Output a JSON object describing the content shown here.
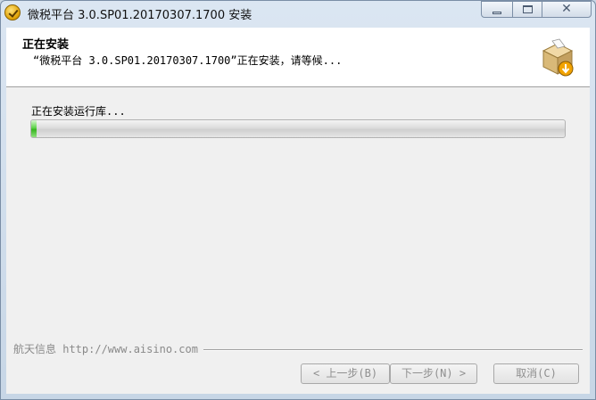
{
  "window": {
    "title": "微税平台 3.0.SP01.20170307.1700 安装",
    "close_glyph": "✕"
  },
  "header": {
    "title": "正在安装",
    "subtitle": "“微税平台 3.0.SP01.20170307.1700”正在安装，请等候..."
  },
  "body": {
    "status_text": "正在安装运行库...",
    "progress_fraction": 0.01
  },
  "footer": {
    "brand_text": "航天信息 http://www.aisino.com",
    "back_label": "< 上一步(B)",
    "next_label": "下一步(N) >",
    "cancel_label": "取消(C)"
  },
  "colors": {
    "progress_green": "#36b51f",
    "disabled_text": "#8f8f8f"
  },
  "icons": [
    "installer-icon",
    "package-install-icon",
    "minimize-icon",
    "maximize-icon",
    "close-icon"
  ]
}
